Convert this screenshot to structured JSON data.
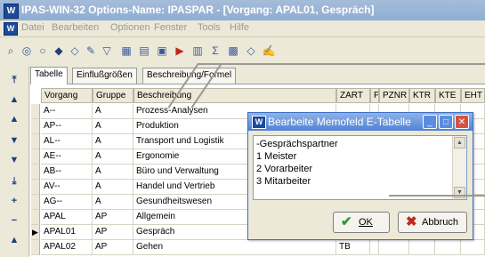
{
  "window": {
    "title": "IPAS-WIN-32   Options-Name: IPASPAR - [Vorgang: APAL01, Gespräch]"
  },
  "menu": [
    "Datei",
    "Bearbeiten",
    "Optionen",
    "Fenster",
    "Tools",
    "Hilfe"
  ],
  "toolbar_icons": [
    "search-icon",
    "binoculars-icon",
    "diamond-icon",
    "filter-icon",
    "edit-icon",
    "funnel-icon",
    "grid-icon",
    "table-icon",
    "report-icon",
    "export-icon",
    "document-icon",
    "sum-icon",
    "spreadsheet-icon",
    "tag-icon",
    "pen-icon"
  ],
  "nav_icons": [
    "first-icon",
    "prev-page-icon",
    "prev-icon",
    "next-icon",
    "next-page-icon",
    "last-icon",
    "add-icon",
    "remove-icon",
    "up-icon"
  ],
  "tabs": [
    "Tabelle",
    "Einflußgrößen",
    "Beschreibung/Formel"
  ],
  "table": {
    "columns": [
      "Vorgang",
      "Gruppe",
      "Beschreibung",
      "ZART",
      "P",
      "PZNR",
      "KTR",
      "KTE",
      "EHT"
    ],
    "rows": [
      [
        "A--",
        "A",
        "Prozess-Analysen"
      ],
      [
        "AP--",
        "A",
        "Produktion"
      ],
      [
        "AL--",
        "A",
        "Transport und Logistik"
      ],
      [
        "AE--",
        "A",
        "Ergonomie"
      ],
      [
        "AB--",
        "A",
        "Büro und Verwaltung"
      ],
      [
        "AV--",
        "A",
        "Handel und Vertrieb"
      ],
      [
        "AG--",
        "A",
        "Gesundheitswesen"
      ],
      [
        "APAL",
        "AP",
        "Allgemein"
      ],
      [
        "APAL01",
        "AP",
        "Gespräch"
      ],
      [
        "APAL02",
        "AP",
        "Gehen",
        "TB"
      ]
    ],
    "selected_row": 8
  },
  "dialog": {
    "title": "Bearbeite Memofeld E-Tabelle",
    "memo_lines": [
      "-Gesprächspartner",
      "1 Meister",
      "2 Vorarbeiter",
      "3 Mitarbeiter"
    ],
    "ok_label": "OK",
    "cancel_label": "Abbruch"
  },
  "colors": {
    "accent": "#4f83d6",
    "ok_check": "#2e9a2e",
    "cancel_x": "#c0281c"
  }
}
